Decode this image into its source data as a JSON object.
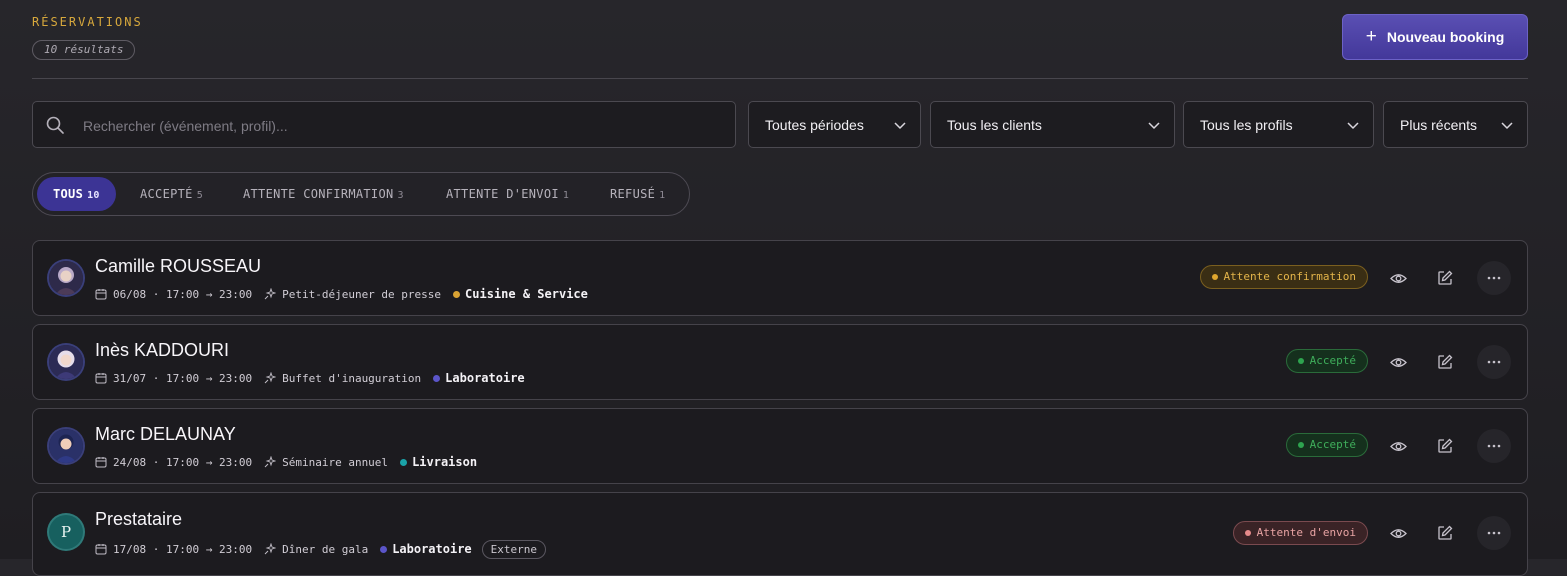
{
  "header": {
    "title": "RÉSERVATIONS",
    "count": "10 résultats",
    "new_button": "Nouveau booking"
  },
  "filters": {
    "search_placeholder": "Rechercher (événement, profil)...",
    "period": "Toutes périodes",
    "clients": "Tous les clients",
    "profiles": "Tous les profils",
    "sort": "Plus récents"
  },
  "tabs": [
    {
      "label": "TOUS",
      "count": "10"
    },
    {
      "label": "ACCEPTÉ",
      "count": "5"
    },
    {
      "label": "ATTENTE CONFIRMATION",
      "count": "3"
    },
    {
      "label": "ATTENTE D'ENVOI",
      "count": "1"
    },
    {
      "label": "REFUSÉ",
      "count": "1"
    }
  ],
  "bookings": [
    {
      "name": "Camille ROUSSEAU",
      "date": "06/08",
      "time": "17:00 → 23:00",
      "event": "Petit-déjeuner de presse",
      "team": "Cuisine & Service",
      "team_color": "#d9a233",
      "status": "Attente confirmation",
      "avatar": "person-female-icon"
    },
    {
      "name": "Inès KADDOURI",
      "date": "31/07",
      "time": "17:00 → 23:00",
      "event": "Buffet d'inauguration",
      "team": "Laboratoire",
      "team_color": "#5b55c9",
      "status": "Accepté",
      "avatar": "person-female-icon"
    },
    {
      "name": "Marc DELAUNAY",
      "date": "24/08",
      "time": "17:00 → 23:00",
      "event": "Séminaire annuel",
      "team": "Livraison",
      "team_color": "#1aa3a8",
      "status": "Accepté",
      "avatar": "person-male-icon"
    },
    {
      "name": "Prestataire",
      "date": "17/08",
      "time": "17:00 → 23:00",
      "event": "Dîner de gala",
      "team": "Laboratoire",
      "team_color": "#5b55c9",
      "status": "Attente d'envoi",
      "badge": "Externe",
      "avatar_initial": "P"
    }
  ],
  "colors": {
    "accent": "#43389a",
    "title_gold": "#d7a83c",
    "status_waiting": "#d9a233",
    "status_accepted": "#2ea44f",
    "status_sending": "#e58a8a"
  }
}
